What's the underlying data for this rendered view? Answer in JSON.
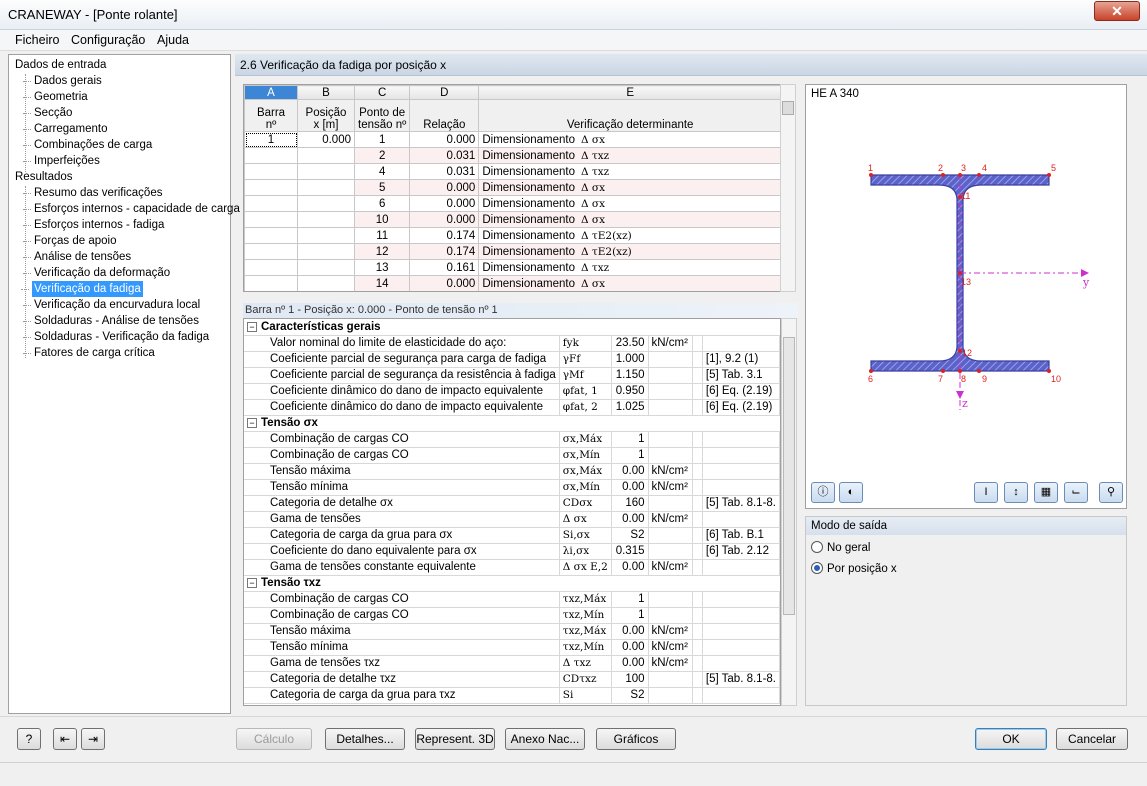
{
  "window": {
    "title": "CRANEWAY - [Ponte rolante]",
    "close_label": "✕"
  },
  "menu": [
    "Ficheiro",
    "Configuração",
    "Ajuda"
  ],
  "nav": {
    "input_header": "Dados de entrada",
    "input_items": [
      "Dados gerais",
      "Geometria",
      "Secção",
      "Carregamento",
      "Combinações de carga",
      "Imperfeições"
    ],
    "results_header": "Resultados",
    "result_items": [
      "Resumo das verificações",
      "Esforços internos - capacidade de carga",
      "Esforços internos - fadiga",
      "Forças de apoio",
      "Análise de tensões",
      "Verificação da deformação",
      "Verificação da fadiga",
      "Verificação da encurvadura local",
      "Soldaduras - Análise de tensões",
      "Soldaduras - Verificação da fadiga",
      "Fatores de carga crítica"
    ],
    "selected": "Verificação da fadiga"
  },
  "section_title": "2.6 Verificação da fadiga por posição x",
  "top_table": {
    "col_letters": [
      "A",
      "B",
      "C",
      "D",
      "E"
    ],
    "headers": [
      [
        "Barra",
        "nº"
      ],
      [
        "Posição",
        "x [m]"
      ],
      [
        "Ponto de",
        "tensão nº"
      ],
      [
        "",
        "Relação"
      ],
      [
        "",
        "Verificação determinante"
      ]
    ],
    "rows": [
      [
        "1",
        "0.000",
        "1",
        "0.000",
        "Dimensionamento",
        "Δ σx"
      ],
      [
        "",
        "",
        "2",
        "0.031",
        "Dimensionamento",
        "Δ τxz"
      ],
      [
        "",
        "",
        "4",
        "0.031",
        "Dimensionamento",
        "Δ τxz"
      ],
      [
        "",
        "",
        "5",
        "0.000",
        "Dimensionamento",
        "Δ σx"
      ],
      [
        "",
        "",
        "6",
        "0.000",
        "Dimensionamento",
        "Δ σx"
      ],
      [
        "",
        "",
        "10",
        "0.000",
        "Dimensionamento",
        "Δ σx"
      ],
      [
        "",
        "",
        "11",
        "0.174",
        "Dimensionamento",
        "Δ τE2(xz)"
      ],
      [
        "",
        "",
        "12",
        "0.174",
        "Dimensionamento",
        "Δ τE2(xz)"
      ],
      [
        "",
        "",
        "13",
        "0.161",
        "Dimensionamento",
        "Δ τxz"
      ],
      [
        "",
        "",
        "14",
        "0.000",
        "Dimensionamento",
        "Δ σx"
      ]
    ]
  },
  "info_line": "Barra nº  1  -  Posição x:  0.000  -  Ponto de tensão nº  1",
  "details": [
    {
      "group": "Características gerais",
      "rows": [
        [
          "Valor nominal do limite de elasticidade do aço:",
          "fyk",
          "23.50",
          "kN/cm²",
          ""
        ],
        [
          "Coeficiente parcial de segurança para carga de fadiga",
          "γFf",
          "1.000",
          "",
          "[1], 9.2 (1)"
        ],
        [
          "Coeficiente parcial de segurança da resistência à fadiga",
          "γMf",
          "1.150",
          "",
          "[5] Tab. 3.1"
        ],
        [
          "Coeficiente dinâmico do dano de impacto equivalente",
          "φfat, 1",
          "0.950",
          "",
          "[6] Eq. (2.19)"
        ],
        [
          "Coeficiente dinâmico do dano de impacto equivalente",
          "φfat, 2",
          "1.025",
          "",
          "[6] Eq. (2.19)"
        ]
      ]
    },
    {
      "group": "Tensão σx",
      "rows": [
        [
          "Combinação de cargas CO",
          "σx,Máx",
          "1",
          "",
          ""
        ],
        [
          "Combinação de cargas CO",
          "σx,Mín",
          "1",
          "",
          ""
        ],
        [
          "Tensão máxima",
          "σx,Máx",
          "0.00",
          "kN/cm²",
          ""
        ],
        [
          "Tensão mínima",
          "σx,Mín",
          "0.00",
          "kN/cm²",
          ""
        ],
        [
          "Categoria de detalhe σx",
          "CDσx",
          "160",
          "",
          "[5] Tab. 8.1-8."
        ],
        [
          "Gama de tensões",
          "Δ σx",
          "0.00",
          "kN/cm²",
          ""
        ],
        [
          "Categoria de carga da grua para σx",
          "Si,σx",
          "S2",
          "",
          "[6] Tab. B.1"
        ],
        [
          "Coeficiente do dano equivalente para σx",
          "λi,σx",
          "0.315",
          "",
          "[6] Tab. 2.12"
        ],
        [
          "Gama de tensões constante equivalente",
          "Δ σx E,2",
          "0.00",
          "kN/cm²",
          ""
        ]
      ]
    },
    {
      "group": "Tensão τxz",
      "rows": [
        [
          "Combinação de cargas CO",
          "τxz,Máx",
          "1",
          "",
          ""
        ],
        [
          "Combinação de cargas CO",
          "τxz,Mín",
          "1",
          "",
          ""
        ],
        [
          "Tensão máxima",
          "τxz,Máx",
          "0.00",
          "kN/cm²",
          ""
        ],
        [
          "Tensão mínima",
          "τxz,Mín",
          "0.00",
          "kN/cm²",
          ""
        ],
        [
          "Gama de tensões τxz",
          "Δ τxz",
          "0.00",
          "kN/cm²",
          ""
        ],
        [
          "Categoria de detalhe τxz",
          "CDτxz",
          "100",
          "",
          "[5] Tab. 8.1-8."
        ],
        [
          "Categoria de carga da grua para τxz",
          "Si",
          "S2",
          "",
          ""
        ]
      ]
    }
  ],
  "graphic": {
    "title": "HE A 340",
    "point_labels": [
      "1",
      "2",
      "3",
      "4",
      "5",
      "11",
      "13",
      "12",
      "6",
      "7",
      "8",
      "9",
      "10"
    ],
    "axis_y": "y",
    "axis_z": "z",
    "section_color": "#5b62c9",
    "point_color": "#e02020"
  },
  "output_mode": {
    "title": "Modo de saída",
    "options": [
      "No geral",
      "Por posição x"
    ],
    "selected": "Por posição x"
  },
  "buttons": {
    "calc": "Cálculo",
    "details": "Detalhes...",
    "render3d": "Represent. 3D",
    "annex": "Anexo Nac...",
    "graphs": "Gráficos",
    "ok": "OK",
    "cancel": "Cancelar"
  }
}
